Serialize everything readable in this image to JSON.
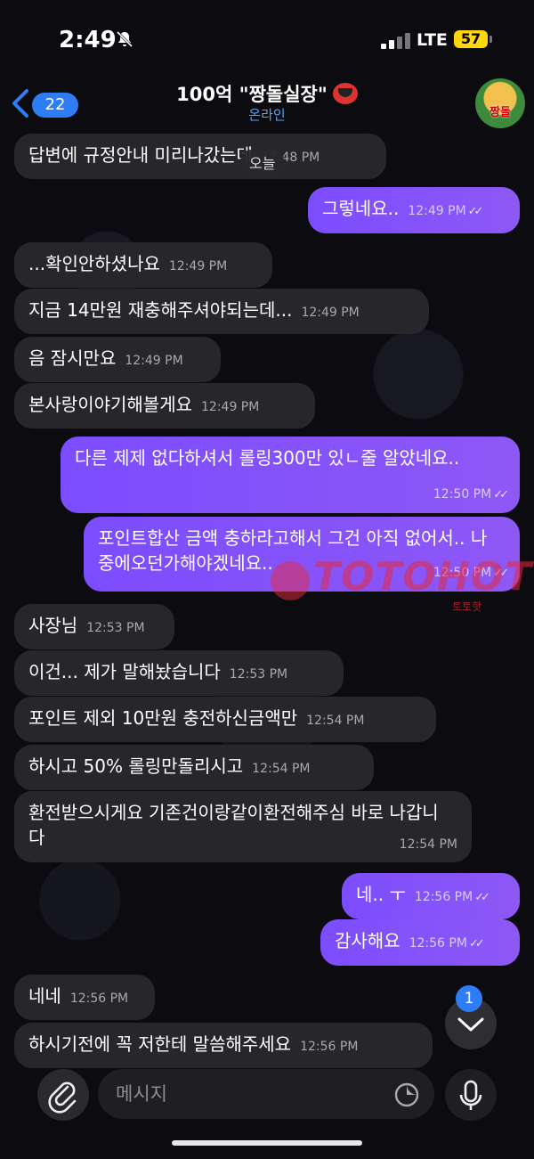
{
  "status": {
    "time": "2:49",
    "network": "LTE",
    "battery": "57"
  },
  "header": {
    "back_count": "22",
    "title": "100억 \"짱돌실장\"",
    "status": "온라인",
    "avatar_label": "짱돌"
  },
  "date_pill": "오늘",
  "messages": [
    {
      "dir": "in",
      "text": "답변에 규정안내 미리나갔는데",
      "time": "12:48 PM"
    },
    {
      "dir": "out",
      "text": "그렇네요..",
      "time": "12:49 PM"
    },
    {
      "dir": "in",
      "text": "...확인안하셨나요",
      "time": "12:49 PM"
    },
    {
      "dir": "in",
      "text": "지금 14만원 재충해주셔야되는데...",
      "time": "12:49 PM"
    },
    {
      "dir": "in",
      "text": "음 잠시만요",
      "time": "12:49 PM"
    },
    {
      "dir": "in",
      "text": "본사랑이야기해볼게요",
      "time": "12:49 PM"
    },
    {
      "dir": "out",
      "text": "다른 제제 없다하셔서 롤링300만 있ㄴ줄 알았네요..",
      "time": "12:50 PM"
    },
    {
      "dir": "out",
      "text": "포인트합산 금액 충하라고해서 그건 아직 없어서.. 나중에오던가해야겠네요..",
      "time": "12:50 PM"
    },
    {
      "dir": "in",
      "text": "사장님",
      "time": "12:53 PM"
    },
    {
      "dir": "in",
      "text": "이건... 제가 말해놨습니다",
      "time": "12:53 PM"
    },
    {
      "dir": "in",
      "text": "포인트 제외 10만원 충전하신금액만",
      "time": "12:54 PM"
    },
    {
      "dir": "in",
      "text": "하시고 50% 롤링만돌리시고",
      "time": "12:54 PM"
    },
    {
      "dir": "in",
      "text": "환전받으시게요 기존건이랑같이환전해주심 바로 나갑니다",
      "time": "12:54 PM"
    },
    {
      "dir": "out",
      "text": "네.. ㅜ",
      "time": "12:56 PM"
    },
    {
      "dir": "out",
      "text": "감사해요",
      "time": "12:56 PM"
    },
    {
      "dir": "in",
      "text": "네네",
      "time": "12:56 PM"
    },
    {
      "dir": "in",
      "text": "하시기전에 꼭 저한테 말씀해주세요",
      "time": "12:56 PM"
    }
  ],
  "read_ticks": "✓✓",
  "watermark": {
    "text": "TOTOHOT",
    "sub": "토토핫"
  },
  "unread_badge": "1",
  "composer": {
    "placeholder": "메시지"
  },
  "icons": {
    "back": "chevron-left-icon",
    "bell_off": "bell-slash-icon",
    "attach": "paperclip-icon",
    "sticker": "sticker-icon",
    "mic": "microphone-icon",
    "scroll": "chevron-down-icon"
  },
  "colors": {
    "outgoing": "#7c4dff",
    "incoming": "#27272b",
    "accent": "#2f7df6",
    "battery": "#ffd60a"
  }
}
